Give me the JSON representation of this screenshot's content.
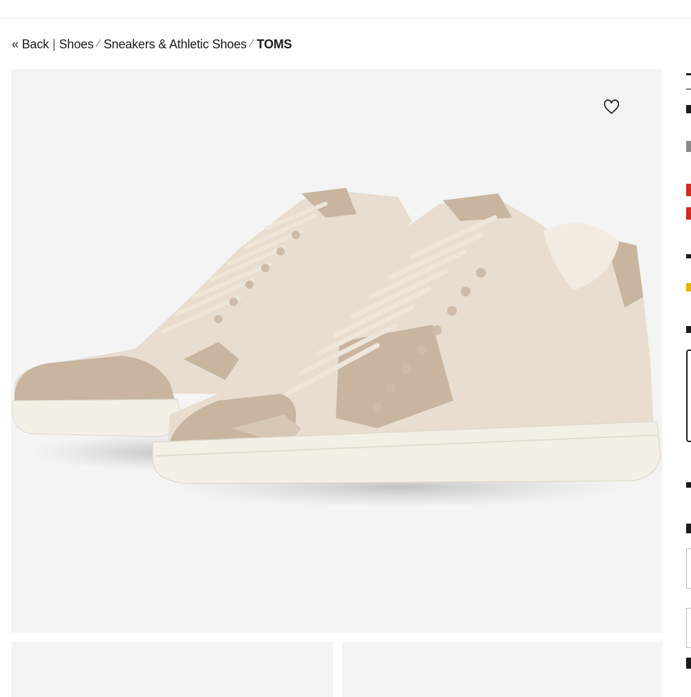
{
  "breadcrumb": {
    "back": "« Back",
    "sep_pipe": "|",
    "category": "Shoes",
    "sep1": "⁄",
    "subcategory": "Sneakers & Athletic Shoes",
    "sep2": "⁄",
    "brand": "TOMS"
  },
  "product": {
    "favorite_icon": "heart-outline-icon",
    "image_alt": "TOMS sneakers"
  },
  "colors": {
    "page_bg": "#ffffff",
    "image_bg": "#f4f4f4",
    "shoe_upper": "#e8ddcf",
    "shoe_suede": "#c9b59f",
    "shoe_sole": "#f3f0e8",
    "sale_red": "#d12b1f"
  }
}
